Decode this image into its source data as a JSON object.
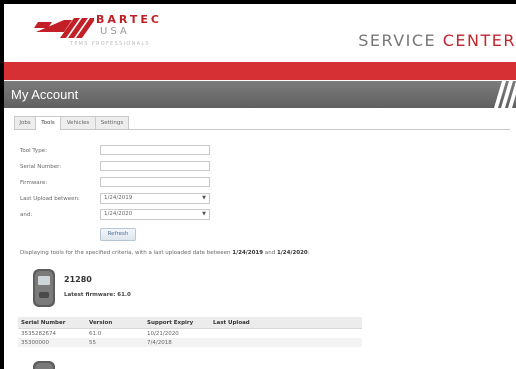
{
  "brand": {
    "name": "BARTEC",
    "region": "USA",
    "tagline": "TPMS PROFESSIONALS",
    "service_title_1": "SERVICE ",
    "service_title_2": "CENTER",
    "accent_color": "#d62f34"
  },
  "page": {
    "title": "My Account"
  },
  "tabs": [
    {
      "label": "Jobs",
      "active": false
    },
    {
      "label": "Tools",
      "active": true
    },
    {
      "label": "Vehicles",
      "active": false
    },
    {
      "label": "Settings",
      "active": false
    }
  ],
  "form": {
    "tool_type_label": "Tool Type:",
    "tool_type_value": "",
    "serial_label": "Serial Number:",
    "serial_value": "",
    "firmware_label": "Firmware:",
    "firmware_value": "",
    "upload_between_label": "Last Upload between:",
    "upload_from": "1/24/2019",
    "and_label": "and:",
    "upload_to": "1/24/2020",
    "refresh_label": "Refresh"
  },
  "criteria": {
    "prefix": "Displaying tools for the specified criteria, with a last uploaded date between ",
    "from": "1/24/2019",
    "middle": " and ",
    "to": "1/24/2020",
    "suffix": ":"
  },
  "tool": {
    "id": "21280",
    "latest_firmware": "Latest firmware: 61.0",
    "icon": "tpms-tool-icon"
  },
  "table": {
    "headers": [
      "Serial Number",
      "Version",
      "Support Expiry",
      "Last Upload"
    ],
    "rows": [
      [
        "3535282674",
        "61.0",
        "10/21/2020",
        ""
      ],
      [
        "35300000",
        "55",
        "7/4/2018",
        ""
      ]
    ]
  }
}
